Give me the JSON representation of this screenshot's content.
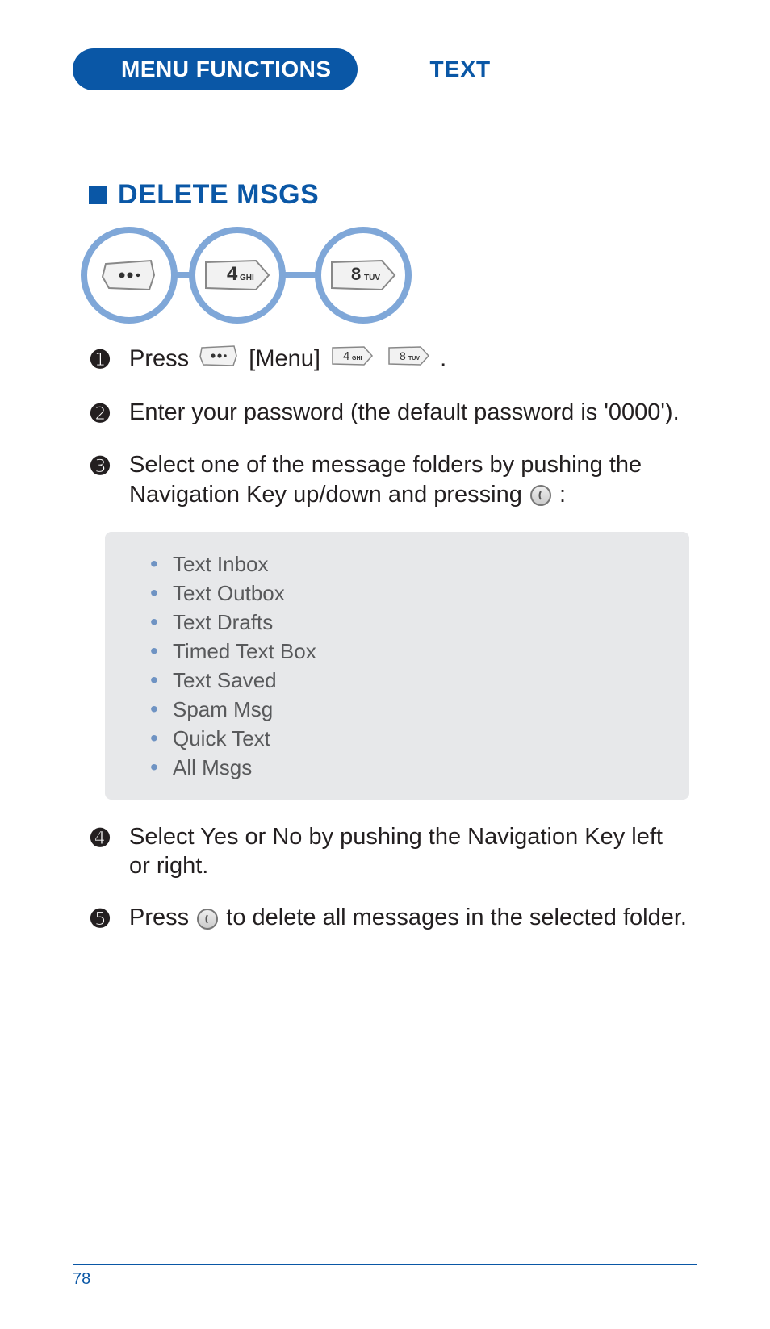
{
  "header": {
    "chapter": "MENU FUNCTIONS",
    "section": "TEXT"
  },
  "heading": "DELETE MSGS",
  "keyseq": {
    "k1_label": "menu-key",
    "k2_num": "4",
    "k2_sub": "GHI",
    "k3_num": "8",
    "k3_sub": "TUV"
  },
  "steps": {
    "s1_a": "Press",
    "s1_b": "[Menu]",
    "s1_c": ".",
    "s2": "Enter your password (the default password is '0000').",
    "s3_a": "Select one of the message folders by pushing the Navigation Key up/down and pressing",
    "s3_b": ":",
    "s4": "Select Yes or No by pushing the Navigation Key left or right.",
    "s5_a": "Press",
    "s5_b": "to delete all messages in the selected folder."
  },
  "folders": [
    "Text Inbox",
    "Text Outbox",
    "Text Drafts",
    "Timed Text Box",
    "Text Saved",
    "Spam Msg",
    "Quick Text",
    "All Msgs"
  ],
  "page_number": "78",
  "nums": {
    "n1": "➊",
    "n2": "➋",
    "n3": "➌",
    "n4": "➍",
    "n5": "➎"
  }
}
